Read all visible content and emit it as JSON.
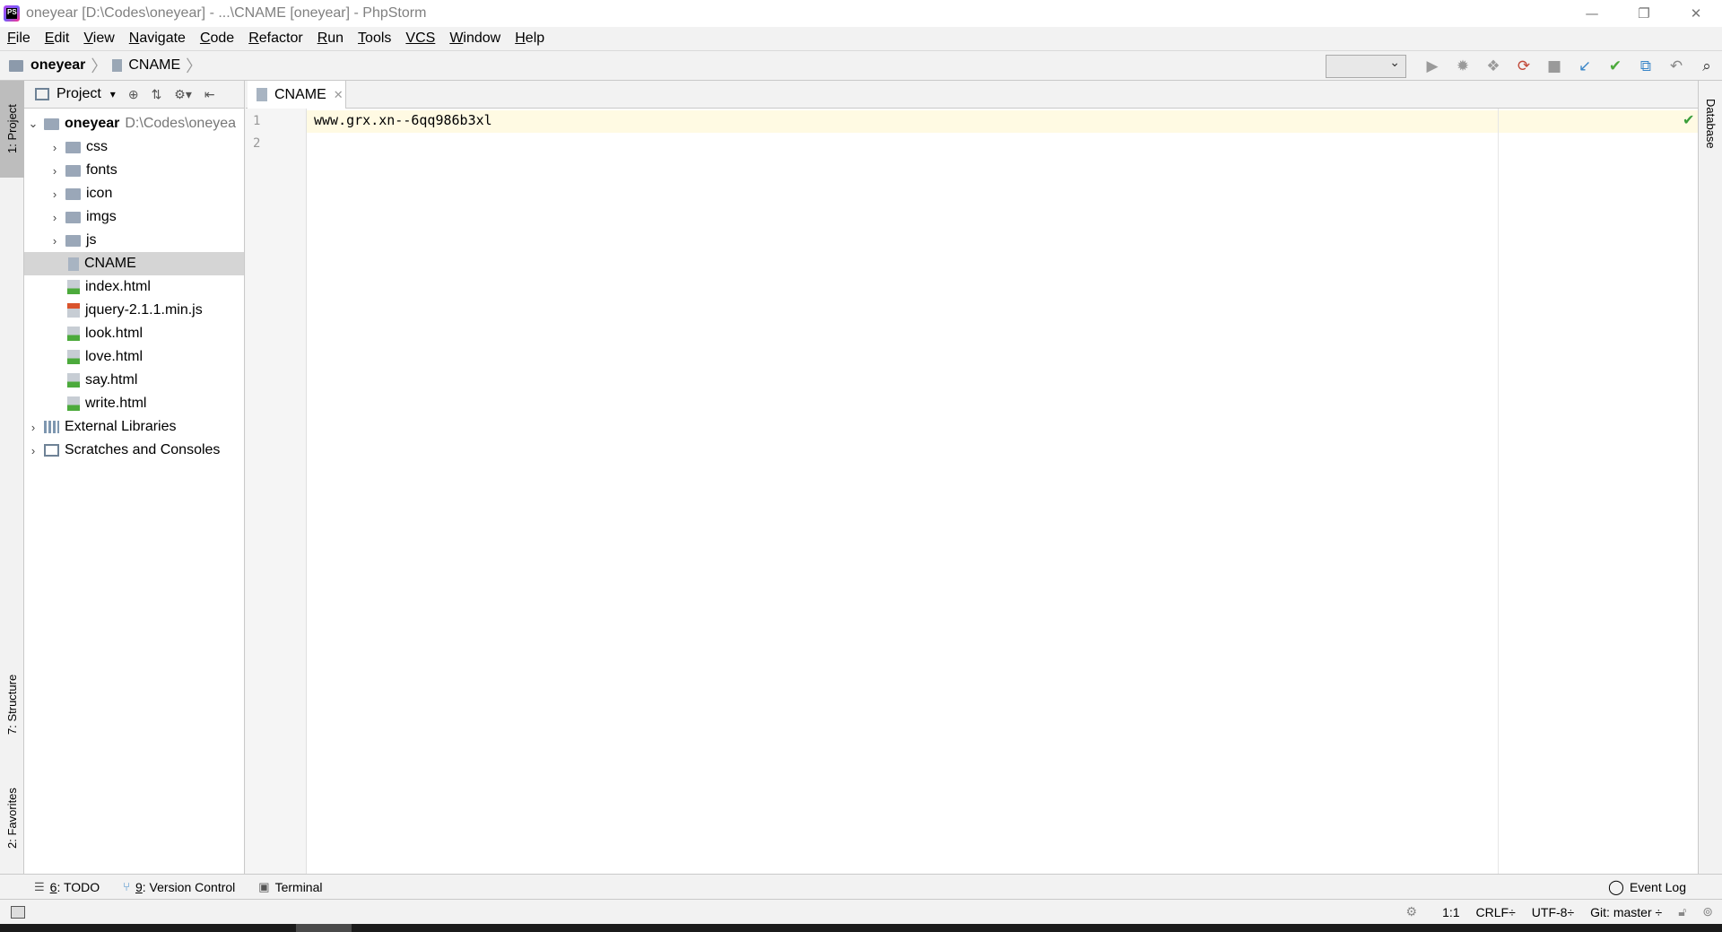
{
  "window": {
    "title": "oneyear [D:\\Codes\\oneyear] - ...\\CNAME [oneyear] - PhpStorm",
    "logo_text": "PS",
    "minimize": "—",
    "restore": "❐",
    "close": "✕"
  },
  "menu": [
    {
      "label_u": "F",
      "label_rest": "ile"
    },
    {
      "label_u": "E",
      "label_rest": "dit"
    },
    {
      "label_u": "V",
      "label_rest": "iew"
    },
    {
      "label_u": "N",
      "label_rest": "avigate"
    },
    {
      "label_u": "C",
      "label_rest": "ode"
    },
    {
      "label_u": "R",
      "label_rest": "efactor"
    },
    {
      "label_u": "R",
      "label_rest": "un"
    },
    {
      "label_u": "T",
      "label_rest": "ools"
    },
    {
      "label_u": "VCS",
      "label_rest": ""
    },
    {
      "label_u": "W",
      "label_rest": "indow"
    },
    {
      "label_u": "H",
      "label_rest": "elp"
    }
  ],
  "breadcrumb": {
    "project": "oneyear",
    "file": "CNAME",
    "sep": "〉"
  },
  "left_tabs": {
    "project": "1: Project",
    "structure": "7: Structure",
    "favorites": "2: Favorites"
  },
  "right_tabs": {
    "database": "Database"
  },
  "project_panel": {
    "title": "Project",
    "dropdown": "▾",
    "tools": [
      "⊕",
      "⇅",
      "⚙▾",
      "⇤"
    ],
    "root": {
      "name": "oneyear",
      "path": "D:\\Codes\\oneyea"
    },
    "folders": [
      "css",
      "fonts",
      "icon",
      "imgs",
      "js"
    ],
    "files": [
      {
        "name": "CNAME",
        "type": "text"
      },
      {
        "name": "index.html",
        "type": "html"
      },
      {
        "name": "jquery-2.1.1.min.js",
        "type": "js"
      },
      {
        "name": "look.html",
        "type": "html"
      },
      {
        "name": "love.html",
        "type": "html"
      },
      {
        "name": "say.html",
        "type": "html"
      },
      {
        "name": "write.html",
        "type": "html"
      }
    ],
    "external": "External Libraries",
    "scratches": "Scratches and Consoles"
  },
  "editor": {
    "tab_label": "CNAME",
    "tab_close": "✕",
    "line_numbers": [
      "1",
      "2"
    ],
    "code_line_1": "www.grx.xn--6qq986b3xl",
    "check": "✔"
  },
  "bottom_tools": {
    "todo_u": "6",
    "todo_rest": ": TODO",
    "vc_u": "9",
    "vc_rest": ": Version Control",
    "terminal": "Terminal",
    "event_log": "Event Log"
  },
  "status": {
    "position": "1:1",
    "line_sep": "CRLF÷",
    "encoding": "UTF-8÷",
    "git": "Git: master ÷"
  }
}
